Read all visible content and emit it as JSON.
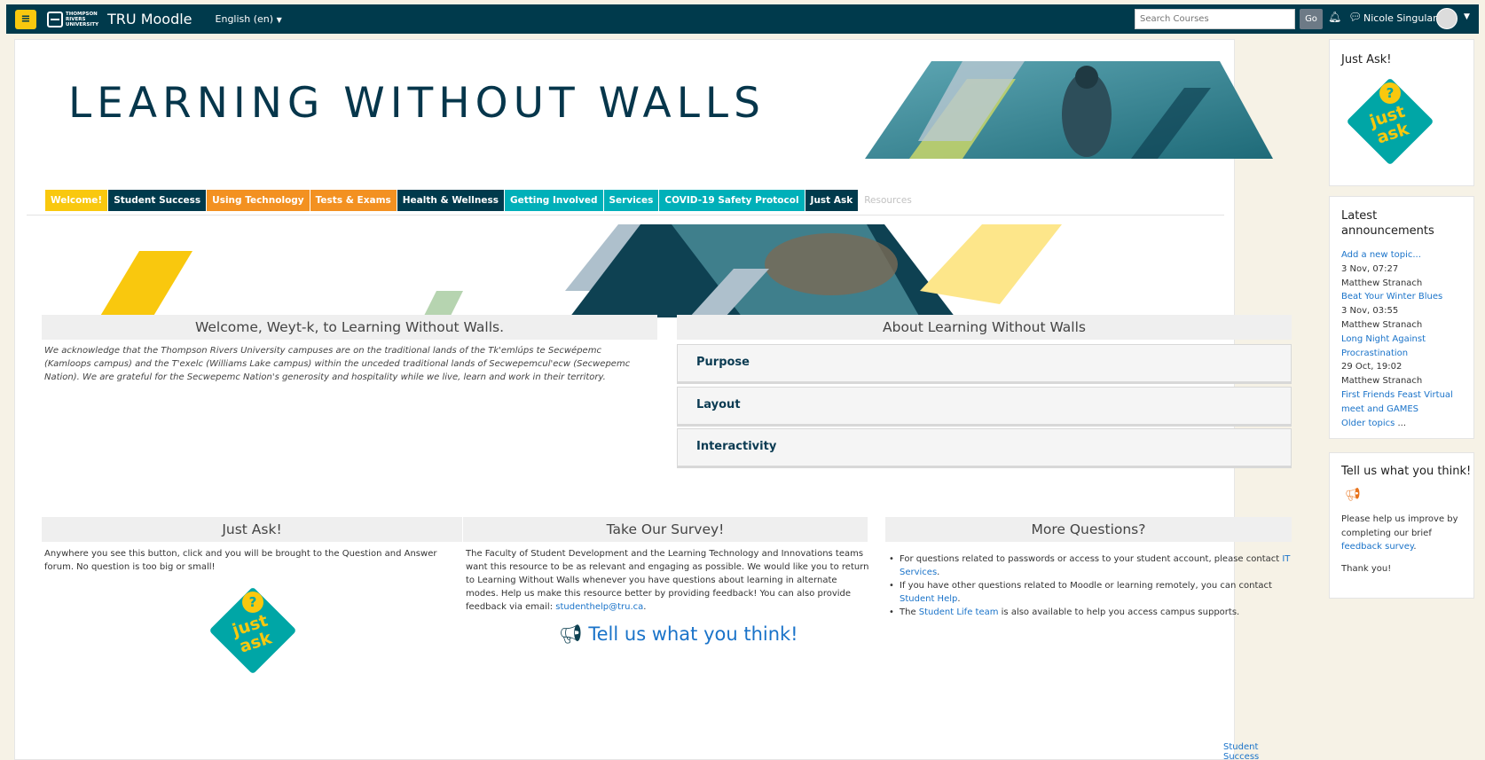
{
  "navbar": {
    "menu_icon": "hamburger-icon",
    "logo_text": "THOMPSON RIVERS UNIVERSITY",
    "site_name": "TRU Moodle",
    "language": "English (en)",
    "search_placeholder": "Search Courses",
    "go_label": "Go",
    "user_name": "Nicole Singular",
    "icons": [
      "bell-icon",
      "chat-icon",
      "avatar",
      "caret-down-icon"
    ]
  },
  "banner": {
    "title": "LEARNING WITHOUT WALLS"
  },
  "tabs": [
    {
      "label": "Welcome!",
      "color": "#f9c80e"
    },
    {
      "label": "Student Success",
      "color": "#003a4c"
    },
    {
      "label": "Using Technology",
      "color": "#f39121"
    },
    {
      "label": "Tests & Exams",
      "color": "#f39121"
    },
    {
      "label": "Health & Wellness",
      "color": "#003a4c"
    },
    {
      "label": "Getting Involved",
      "color": "#00b0b9"
    },
    {
      "label": "Services",
      "color": "#00b0b9"
    },
    {
      "label": "COVID-19 Safety Protocol",
      "color": "#00b0b9"
    },
    {
      "label": "Just Ask",
      "color": "#003a4c"
    },
    {
      "label": "Resources",
      "color": "#ffffff"
    }
  ],
  "welcome": {
    "heading": "Welcome, Weyt-k, to Learning Without Walls.",
    "body": "We acknowledge that the Thompson Rivers University campuses are on the traditional lands of the Tk'emlúps te Secwépemc (Kamloops campus) and the T'exelc (Williams Lake campus) within the unceded traditional lands of Secwepemcul'ecw (Secwepemc Nation).  We are grateful for the Secwepemc Nation's generosity and hospitality while we live, learn and work in their territory."
  },
  "about": {
    "heading": "About Learning Without Walls",
    "items": [
      "Purpose",
      "Layout",
      "Interactivity"
    ]
  },
  "just_ask": {
    "heading": "Just Ask!",
    "body": "Anywhere you see this button, click and you will be brought to the Question and Answer forum. No question is too big or small!",
    "badge_q": "?",
    "badge_text": "just ask"
  },
  "survey": {
    "heading": "Take Our Survey!",
    "body": "The Faculty of Student Development and the Learning Technology and Innovations teams want this resource to be as relevant and engaging as possible. We would like you to return to Learning Without Walls whenever you have questions about learning in alternate modes. Help us make this resource better by providing feedback! You can also provide feedback via email: ",
    "email": "studenthelp@tru.ca",
    "period": ".",
    "cta": "Tell us what you think!",
    "cta_icon": "megaphone-icon"
  },
  "more": {
    "heading": "More Questions?",
    "items": [
      {
        "text": "For questions related to passwords or access to your student account, please contact ",
        "link": "IT Services",
        "after": "."
      },
      {
        "text": "If you have other questions related to Moodle or learning remotely, you can contact ",
        "link": "Student Help",
        "after": "."
      },
      {
        "text": "The ",
        "link": "Student Life team",
        "after": " is also available to help you access campus supports."
      }
    ]
  },
  "footer": {
    "next_link": "Student Success ▶"
  },
  "sidebar": {
    "just_ask_title": "Just Ask!",
    "announcements": {
      "title": "Latest announcements",
      "add_link": "Add a new topic...",
      "posts": [
        {
          "date": "3 Nov, 07:27",
          "author": "Matthew Stranach",
          "title": "Beat Your Winter Blues"
        },
        {
          "date": "3 Nov, 03:55",
          "author": "Matthew Stranach",
          "title": "Long Night Against Procrastination"
        },
        {
          "date": "29 Oct, 19:02",
          "author": "Matthew Stranach",
          "title": "First Friends Feast Virtual meet and GAMES"
        }
      ],
      "older_link": "Older topics",
      "older_suffix": " ..."
    },
    "feedback": {
      "title": "Tell us what you think!",
      "icon": "megaphone-icon",
      "body_pre": "Please help us improve by completing our brief ",
      "link": "feedback survey",
      "body_post": ".",
      "thanks": "Thank you!"
    }
  }
}
